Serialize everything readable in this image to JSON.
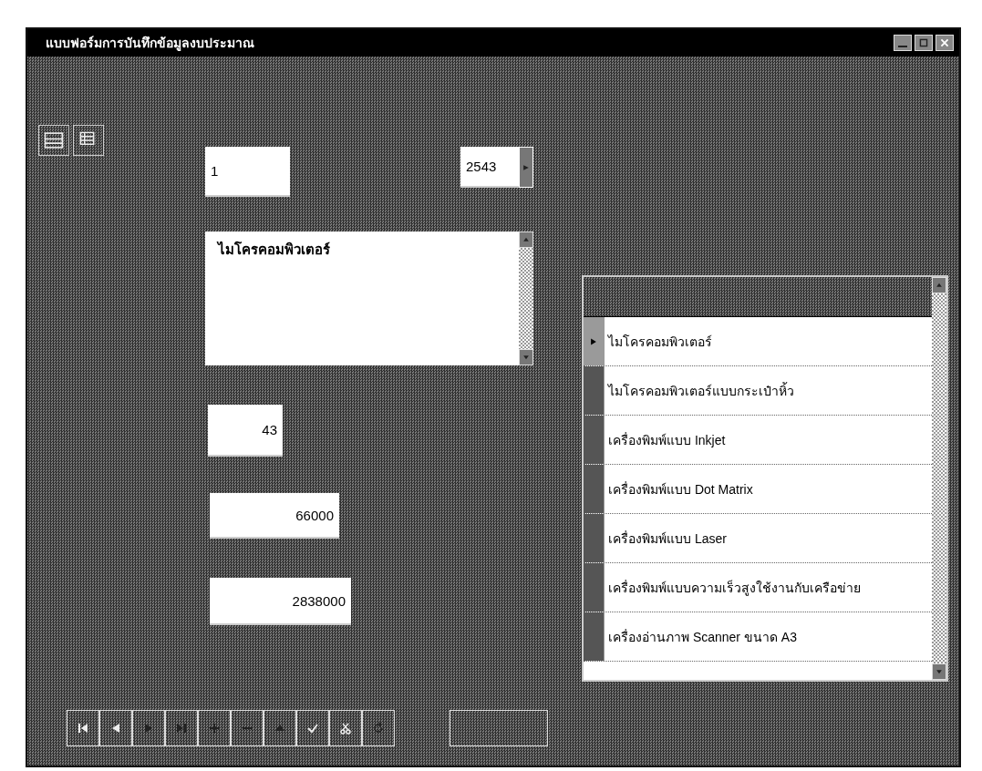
{
  "window": {
    "title": "แบบฟอร์มการบันทึกข้อมูลงบประมาณ"
  },
  "fields": [
    {
      "kind": "text",
      "value": "1"
    },
    {
      "kind": "spin",
      "value": "2543"
    },
    {
      "kind": "memo",
      "value": "ไมโครคอมพิวเตอร์"
    },
    {
      "kind": "number",
      "value": "43"
    },
    {
      "kind": "number",
      "value": "66000"
    },
    {
      "kind": "number",
      "value": "2838000"
    }
  ],
  "list": {
    "rows": [
      {
        "text": "ไมโครคอมพิวเตอร์",
        "selected": true
      },
      {
        "text": "ไมโครคอมพิวเตอร์แบบกระเป๋าหิ้ว",
        "selected": false
      },
      {
        "text": "เครื่องพิมพ์แบบ Inkjet",
        "selected": false
      },
      {
        "text": "เครื่องพิมพ์แบบ Dot Matrix",
        "selected": false
      },
      {
        "text": "เครื่องพิมพ์แบบ Laser",
        "selected": false
      },
      {
        "text": "เครื่องพิมพ์แบบความเร็วสูงใช้งานกับเครือข่าย",
        "selected": false
      },
      {
        "text": "เครื่องอ่านภาพ Scanner ขนาด A3",
        "selected": false
      }
    ]
  }
}
